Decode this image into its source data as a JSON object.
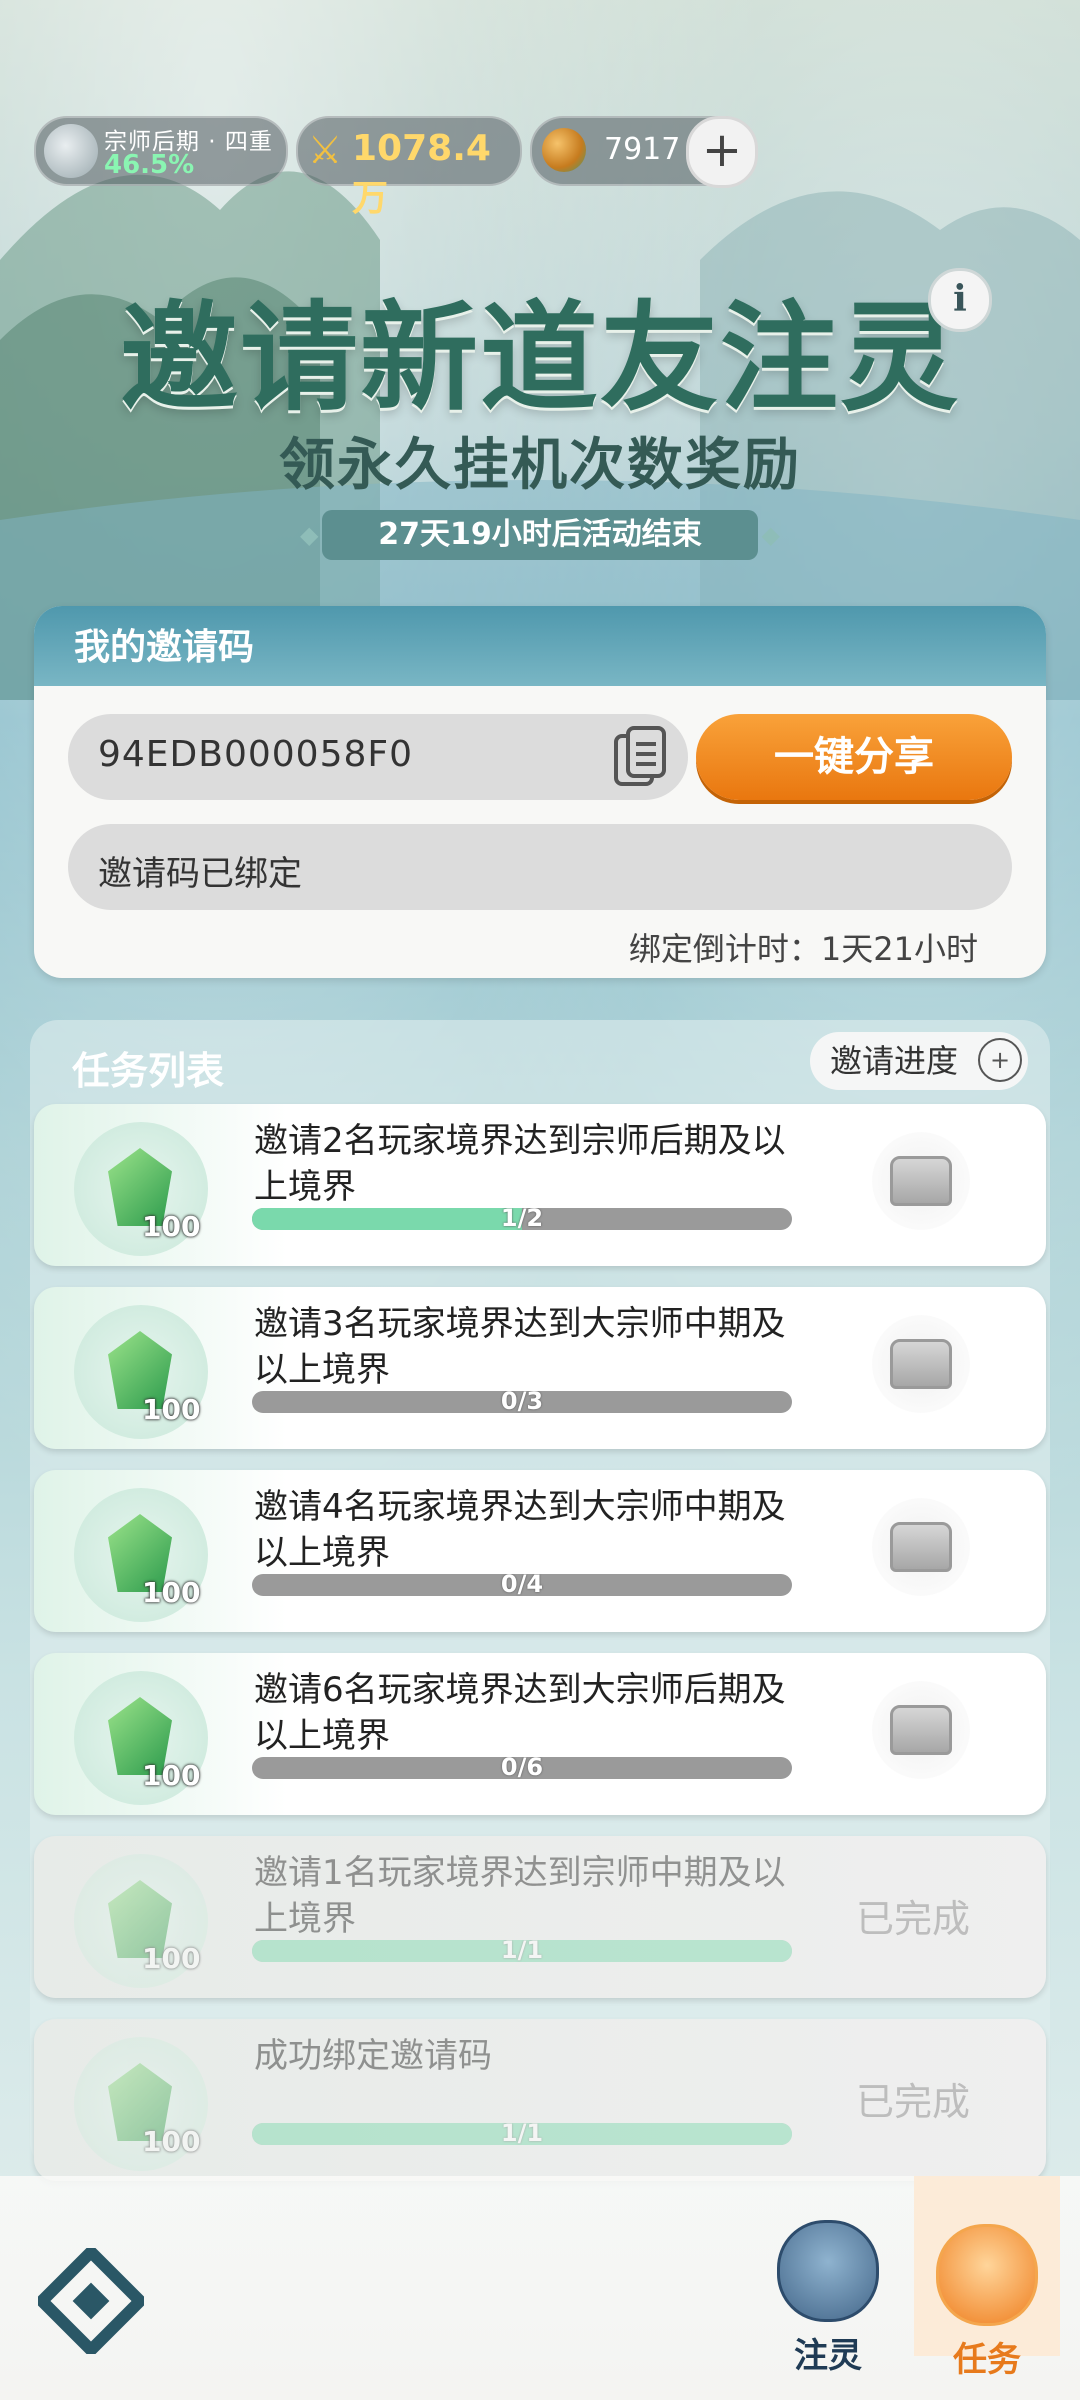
{
  "status": {
    "realm_name": "宗师后期 · 四重",
    "realm_progress": "46.5%",
    "power": "1078.4万",
    "currency": "7917",
    "add_label": "+"
  },
  "hero": {
    "title": "邀请新道友注灵",
    "subtitle": "领永久挂机次数奖励",
    "event_countdown": "27天19小时后活动结束",
    "info_label": "i"
  },
  "invite": {
    "header": "我的邀请码",
    "code": "94EDB000058F0",
    "share_label": "一键分享",
    "bound_status": "邀请码已绑定",
    "bind_countdown": "绑定倒计时：1天21小时"
  },
  "tasks": {
    "header": "任务列表",
    "progress_button": "邀请进度",
    "items": [
      {
        "title": "邀请2名玩家境界达到宗师后期及以上境界",
        "reward": "100",
        "progress_text": "1/2",
        "progress": 0.5,
        "done": false
      },
      {
        "title": "邀请3名玩家境界达到大宗师中期及以上境界",
        "reward": "100",
        "progress_text": "0/3",
        "progress": 0,
        "done": false
      },
      {
        "title": "邀请4名玩家境界达到大宗师中期及以上境界",
        "reward": "100",
        "progress_text": "0/4",
        "progress": 0,
        "done": false
      },
      {
        "title": "邀请6名玩家境界达到大宗师后期及以上境界",
        "reward": "100",
        "progress_text": "0/6",
        "progress": 0,
        "done": false
      },
      {
        "title": "邀请1名玩家境界达到宗师中期及以上境界",
        "reward": "100",
        "progress_text": "1/1",
        "progress": 1,
        "done": true,
        "status": "已完成"
      },
      {
        "title": "成功绑定邀请码",
        "reward": "100",
        "progress_text": "1/1",
        "progress": 1,
        "done": true,
        "status": "已完成"
      }
    ]
  },
  "nav": {
    "spirit_label": "注灵",
    "task_label": "任务"
  },
  "colors": {
    "accent_orange": "#e9770f",
    "progress_green": "#7ad9ac",
    "title_teal": "#2f6d5e"
  }
}
